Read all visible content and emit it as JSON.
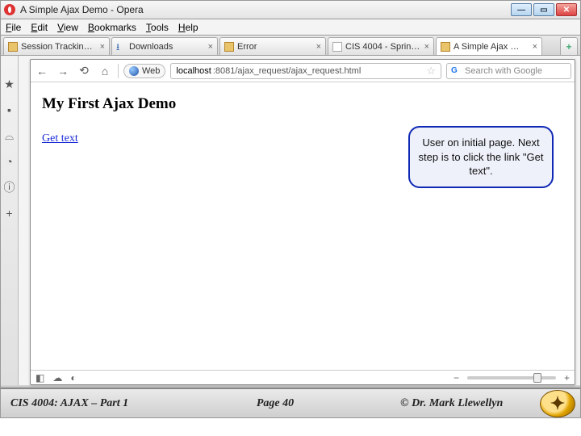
{
  "window": {
    "title": "A Simple Ajax Demo - Opera"
  },
  "menu": {
    "file": "File",
    "edit": "Edit",
    "view": "View",
    "bookmarks": "Bookmarks",
    "tools": "Tools",
    "help": "Help"
  },
  "tabs": [
    {
      "label": "Session Trackin…",
      "kind": "favicon"
    },
    {
      "label": "Downloads",
      "kind": "dl"
    },
    {
      "label": "Error",
      "kind": "favicon"
    },
    {
      "label": "CIS 4004 - Sprin…",
      "kind": "page"
    },
    {
      "label": "A Simple Ajax …",
      "kind": "favicon",
      "active": true
    }
  ],
  "addr": {
    "scheme_label": "Web",
    "host": "localhost",
    "rest": ":8081/ajax_request/ajax_request.html",
    "search_placeholder": "Search with Google"
  },
  "page": {
    "heading": "My First Ajax Demo",
    "link_text": "Get text",
    "callout": "User on initial page. Next step is to click the link \"Get text\"."
  },
  "footer": {
    "left": "CIS 4004: AJAX – Part 1",
    "center": "Page 40",
    "right": "© Dr. Mark Llewellyn"
  }
}
